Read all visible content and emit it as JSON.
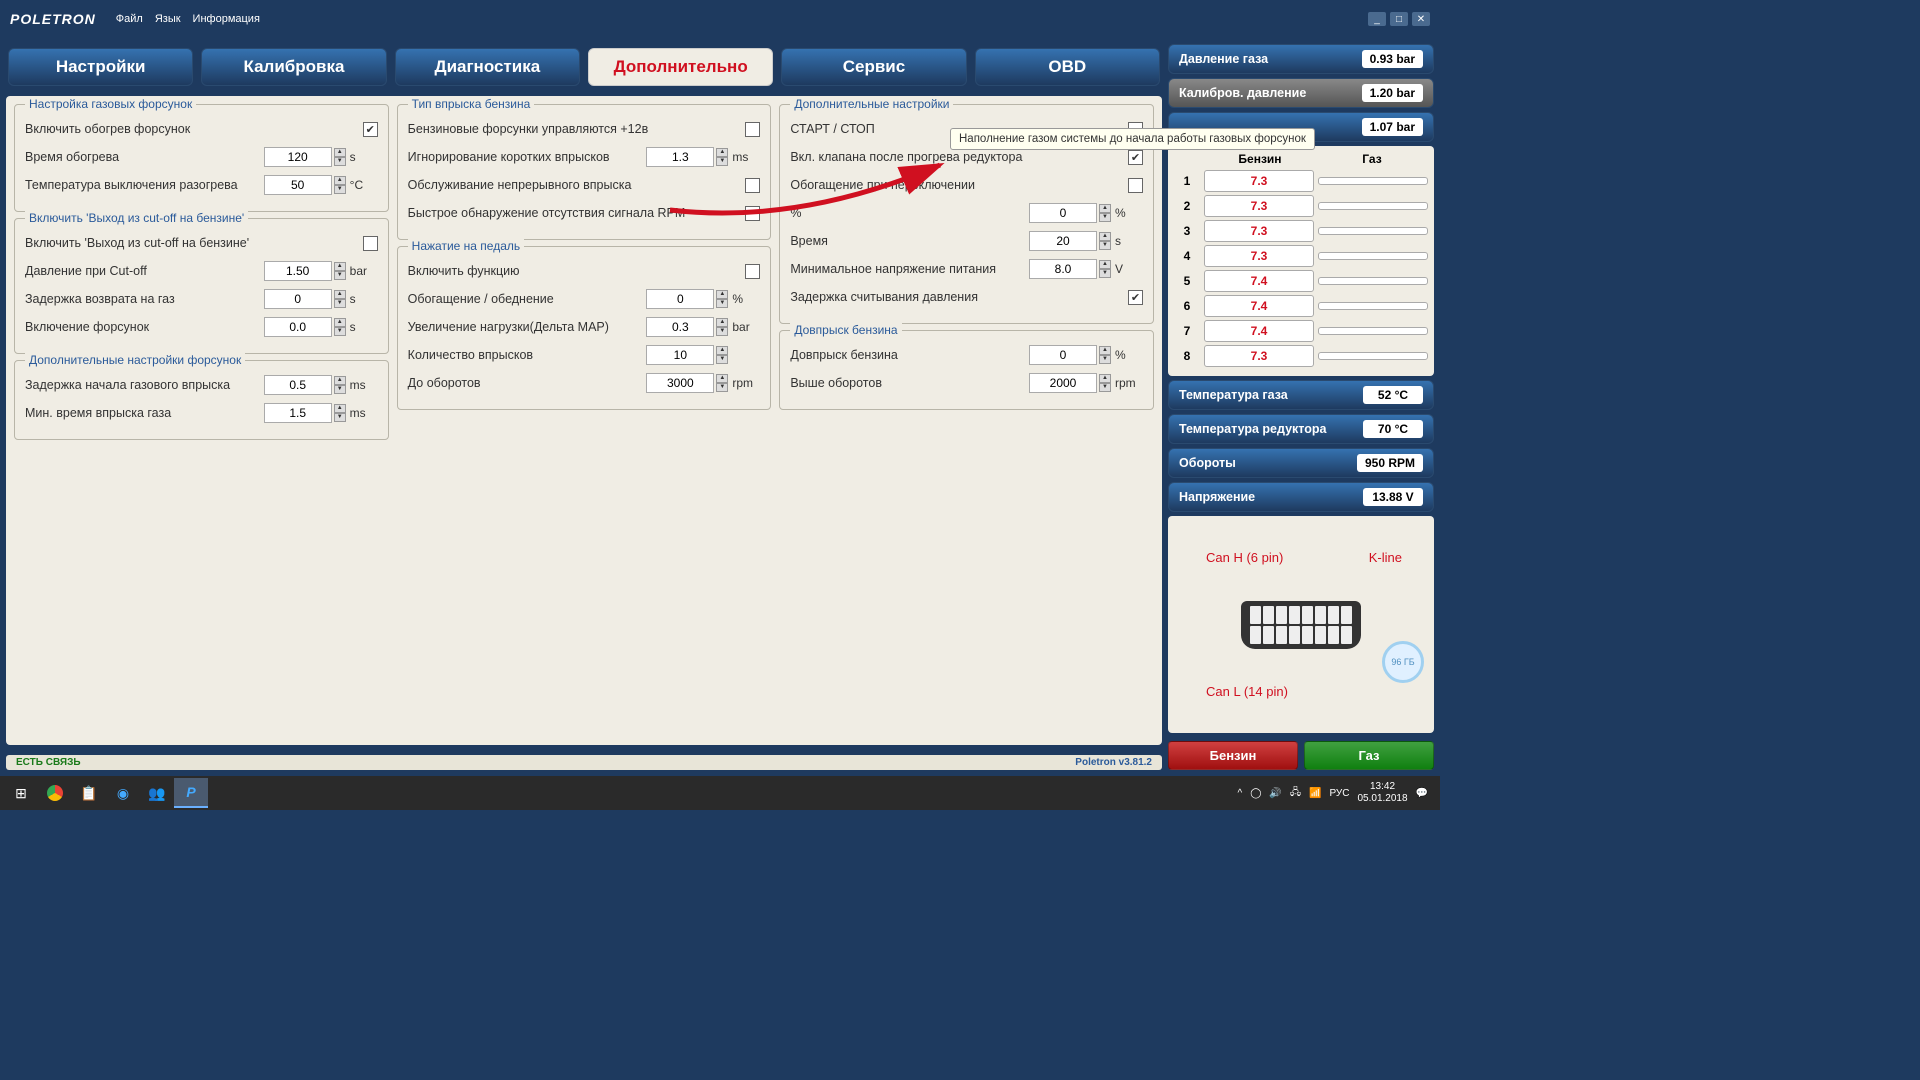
{
  "titlebar": {
    "logo": "POLETRON",
    "menu": {
      "file": "Файл",
      "lang": "Язык",
      "info": "Информация"
    }
  },
  "tabs": {
    "settings": "Настройки",
    "calibration": "Калибровка",
    "diagnostics": "Диагностика",
    "additional": "Дополнительно",
    "service": "Сервис",
    "obd": "OBD"
  },
  "groups": {
    "injector_setup": {
      "title": "Настройка газовых форсунок",
      "heat_enable": "Включить обогрев форсунок",
      "heat_time": "Время обогрева",
      "heat_time_val": "120",
      "heat_time_unit": "s",
      "heat_off_temp": "Температура выключения разогрева",
      "heat_off_temp_val": "50",
      "heat_off_temp_unit": "°C"
    },
    "cutoff": {
      "title": "Включить 'Выход из cut-off на бензине'",
      "enable": "Включить 'Выход из cut-off на бензине'",
      "pressure": "Давление при Cut-off",
      "pressure_val": "1.50",
      "pressure_unit": "bar",
      "return_delay": "Задержка возврата на газ",
      "return_delay_val": "0",
      "return_delay_unit": "s",
      "inj_on": "Включение форсунок",
      "inj_on_val": "0.0",
      "inj_on_unit": "s"
    },
    "inj_extra": {
      "title": "Дополнительные настройки форсунок",
      "start_delay": "Задержка начала газового впрыска",
      "start_delay_val": "0.5",
      "start_delay_unit": "ms",
      "min_time": "Мин. время впрыска газа",
      "min_time_val": "1.5",
      "min_time_unit": "ms"
    },
    "petrol_type": {
      "title": "Тип впрыска бензина",
      "plus12v": "Бензиновые форсунки управляются +12в",
      "ignore_short": "Игнорирование коротких впрысков",
      "ignore_short_val": "1.3",
      "ignore_short_unit": "ms",
      "cont_service": "Обслуживание непрерывного впрыска",
      "fast_rpm": "Быстрое обнаружение отсутствия сигнала RPM"
    },
    "pedal": {
      "title": "Нажатие на педаль",
      "enable": "Включить функцию",
      "enrich": "Обогащение / обеднение",
      "enrich_val": "0",
      "enrich_unit": "%",
      "delta_map": "Увеличение нагрузки(Дельта МАР)",
      "delta_map_val": "0.3",
      "delta_map_unit": "bar",
      "inj_count": "Количество впрысков",
      "inj_count_val": "10",
      "to_rpm": "До оборотов",
      "to_rpm_val": "3000",
      "to_rpm_unit": "rpm"
    },
    "extra": {
      "title": "Дополнительные настройки",
      "startstop": "СТАРТ / СТОП",
      "valve_warm": "Вкл. клапана после прогрева редуктора",
      "enrich_switch": "Обогащение при переключении",
      "pct": "%",
      "pct_val": "0",
      "pct_unit": "%",
      "time": "Время",
      "time_val": "20",
      "time_unit": "s",
      "min_voltage": "Минимальное напряжение питания",
      "min_voltage_val": "8.0",
      "min_voltage_unit": "V",
      "pressure_delay": "Задержка считывания давления"
    },
    "pre_inject": {
      "title": "Довпрыск бензина",
      "enable": "Довпрыск бензина",
      "enable_val": "0",
      "enable_unit": "%",
      "above_rpm": "Выше оборотов",
      "above_rpm_val": "2000",
      "above_rpm_unit": "rpm"
    }
  },
  "tooltip": "Наполнение газом системы до начала работы газовых форсунок",
  "footer": {
    "status": "ЕСТЬ СВЯЗЬ",
    "version": "Poletron v3.81.2"
  },
  "indicators": {
    "gas_pressure": {
      "label": "Давление газа",
      "val": "0.93 bar"
    },
    "calib_pressure": {
      "label": "Калибров. давление",
      "val": "1.20 bar"
    },
    "hidden": {
      "val": "1.07 bar"
    },
    "gas_temp": {
      "label": "Температура газа",
      "val": "52 °C"
    },
    "reducer_temp": {
      "label": "Температура редуктора",
      "val": "70 °C"
    },
    "rpm": {
      "label": "Обороты",
      "val": "950 RPM"
    },
    "voltage": {
      "label": "Напряжение",
      "val": "13.88 V"
    }
  },
  "inj_table": {
    "h_petrol": "Бензин",
    "h_gas": "Газ",
    "rows": [
      {
        "n": "1",
        "p": "7.3",
        "g": ""
      },
      {
        "n": "2",
        "p": "7.3",
        "g": ""
      },
      {
        "n": "3",
        "p": "7.3",
        "g": ""
      },
      {
        "n": "4",
        "p": "7.3",
        "g": ""
      },
      {
        "n": "5",
        "p": "7.4",
        "g": ""
      },
      {
        "n": "6",
        "p": "7.4",
        "g": ""
      },
      {
        "n": "7",
        "p": "7.4",
        "g": ""
      },
      {
        "n": "8",
        "p": "7.3",
        "g": ""
      }
    ]
  },
  "obd": {
    "canh": "Can H (6 pin)",
    "kline": "K-line",
    "canl": "Can L (14 pin)",
    "disk": "96 ГБ"
  },
  "fuel": {
    "petrol": "Бензин",
    "gas": "Газ"
  },
  "tray": {
    "lang": "РУС",
    "time": "13:42",
    "date": "05.01.2018"
  }
}
